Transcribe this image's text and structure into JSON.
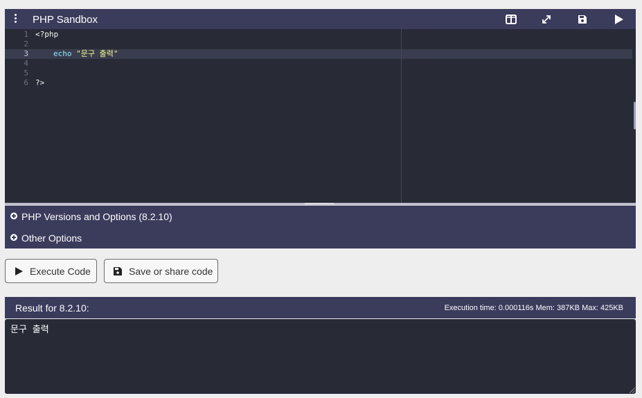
{
  "toolbar": {
    "title": "PHP Sandbox",
    "icons": [
      "menu-kebab-icon",
      "split-view-icon",
      "fullscreen-icon",
      "save-icon",
      "run-icon"
    ]
  },
  "editor": {
    "line_numbers": [
      "1",
      "2",
      "3",
      "4",
      "5",
      "6"
    ],
    "lines": [
      {
        "text": "<?php"
      },
      {
        "text": ""
      },
      {
        "keyword": "echo",
        "string": "\"문구 출력\""
      },
      {
        "text": ""
      },
      {
        "text": ""
      },
      {
        "text": "?>"
      }
    ],
    "active_line": 3
  },
  "sections": {
    "versions_label": "PHP Versions and Options (8.2.10)",
    "other_label": "Other Options"
  },
  "buttons": {
    "execute_label": "Execute Code",
    "share_label": "Save or share code"
  },
  "result": {
    "title": "Result for 8.2.10:",
    "stats": "Execution time: 0.000116s Mem: 387KB Max: 425KB",
    "output": "문구 출력"
  },
  "colors": {
    "header_bg": "#3b3b5c",
    "editor_bg": "#282a36",
    "keyword": "#8be9fd",
    "string": "#f1fa8c",
    "page_bg": "#eeeeee"
  }
}
